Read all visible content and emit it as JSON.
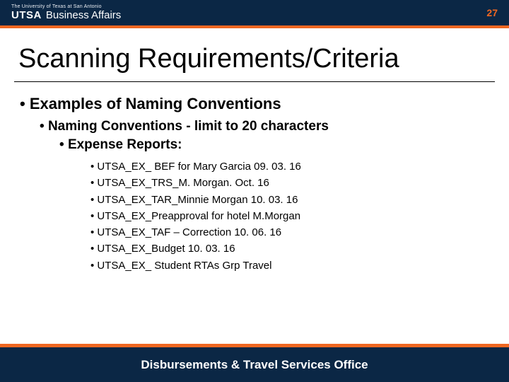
{
  "header": {
    "university": "The University of Texas at San Antonio",
    "brand_primary": "UTSA",
    "brand_secondary": "Business Affairs",
    "page_number": "27"
  },
  "title": "Scanning Requirements/Criteria",
  "bullets": {
    "level1": "Examples of Naming Conventions",
    "level2": "Naming Conventions - limit to 20 characters",
    "level3": "Expense Reports:"
  },
  "examples": [
    "UTSA_EX_ BEF for Mary Garcia 09. 03. 16",
    "UTSA_EX_TRS_M. Morgan. Oct. 16",
    "UTSA_EX_TAR_Minnie Morgan 10. 03. 16",
    "UTSA_EX_Preapproval for hotel M.Morgan",
    "UTSA_EX_TAF – Correction  10. 06. 16",
    "UTSA_EX_Budget 10. 03. 16",
    "UTSA_EX_ Student RTAs Grp Travel"
  ],
  "footer": "Disbursements & Travel Services Office"
}
